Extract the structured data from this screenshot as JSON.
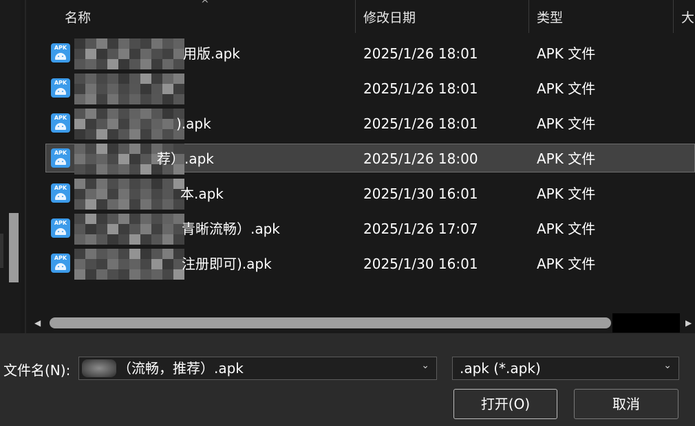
{
  "columns": {
    "name": "名称",
    "date": "修改日期",
    "type": "类型",
    "size": "大"
  },
  "sort_indicator": "^",
  "files": [
    {
      "name_suffix": "用版.apk",
      "date": "2025/1/26 18:01",
      "type": "APK 文件",
      "icon_label": "APK",
      "icon": "apk-android-icon",
      "selected": false
    },
    {
      "name_suffix": "",
      "date": "2025/1/26 18:01",
      "type": "APK 文件",
      "icon_label": "APK",
      "icon": "apk-android-icon",
      "selected": false
    },
    {
      "name_suffix": ").apk",
      "date": "2025/1/26 18:01",
      "type": "APK 文件",
      "icon_label": "APK",
      "icon": "apk-android-icon",
      "selected": false
    },
    {
      "name_suffix": "荐）.apk",
      "date": "2025/1/26 18:00",
      "type": "APK 文件",
      "icon_label": "APK",
      "icon": "apk-android-icon",
      "selected": true
    },
    {
      "name_suffix": "本.apk",
      "date": "2025/1/30 16:01",
      "type": "APK 文件",
      "icon_label": "APK",
      "icon": "apk-android-icon",
      "selected": false
    },
    {
      "name_suffix": "青晰流畅）.apk",
      "date": "2025/1/26 17:07",
      "type": "APK 文件",
      "icon_label": "APK",
      "icon": "apk-android-icon",
      "selected": false
    },
    {
      "name_suffix": "注册即可).apk",
      "date": "2025/1/30 16:01",
      "type": "APK 文件",
      "icon_label": "APK",
      "icon": "apk-android-icon",
      "selected": false
    }
  ],
  "filename": {
    "label": "文件名(N):",
    "value": "（流畅，推荐）.apk"
  },
  "filetype": {
    "value": ".apk (*.apk)"
  },
  "buttons": {
    "open": "打开(O)",
    "cancel": "取消"
  },
  "glyphs": {
    "chevron_down": "⌄",
    "scroll_left": "◀",
    "scroll_right": "▶"
  }
}
